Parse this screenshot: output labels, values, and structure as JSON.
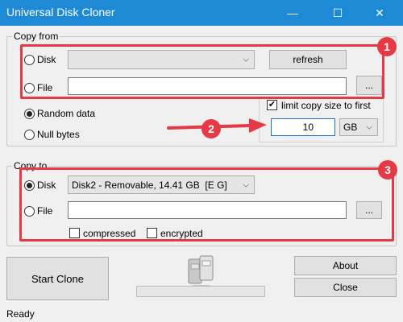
{
  "window": {
    "title": "Universal Disk Cloner",
    "minimize": "—",
    "maximize": "☐",
    "close": "✕"
  },
  "copy_from": {
    "legend": "Copy from",
    "disk_label": "Disk",
    "disk_value": "",
    "refresh_label": "refresh",
    "file_label": "File",
    "file_value": "",
    "browse_label": "...",
    "random_label": "Random data",
    "null_label": "Null bytes",
    "selected": "Random data",
    "limit_label": "limit copy size to first",
    "limit_checked": true,
    "limit_value": "10",
    "limit_unit": "GB"
  },
  "copy_to": {
    "legend": "Copy to",
    "disk_label": "Disk",
    "disk_value": "Disk2 - Removable, 14.41 GB  [E G]",
    "file_label": "File",
    "file_value": "",
    "browse_label": "...",
    "compressed_label": "compressed",
    "encrypted_label": "encrypted",
    "selected": "Disk"
  },
  "actions": {
    "start_label": "Start Clone",
    "about_label": "About",
    "close_label": "Close",
    "progress": 0
  },
  "status": "Ready",
  "annotations": {
    "badge1": "1",
    "badge2": "2",
    "badge3": "3",
    "accent_color": "#e53945"
  }
}
